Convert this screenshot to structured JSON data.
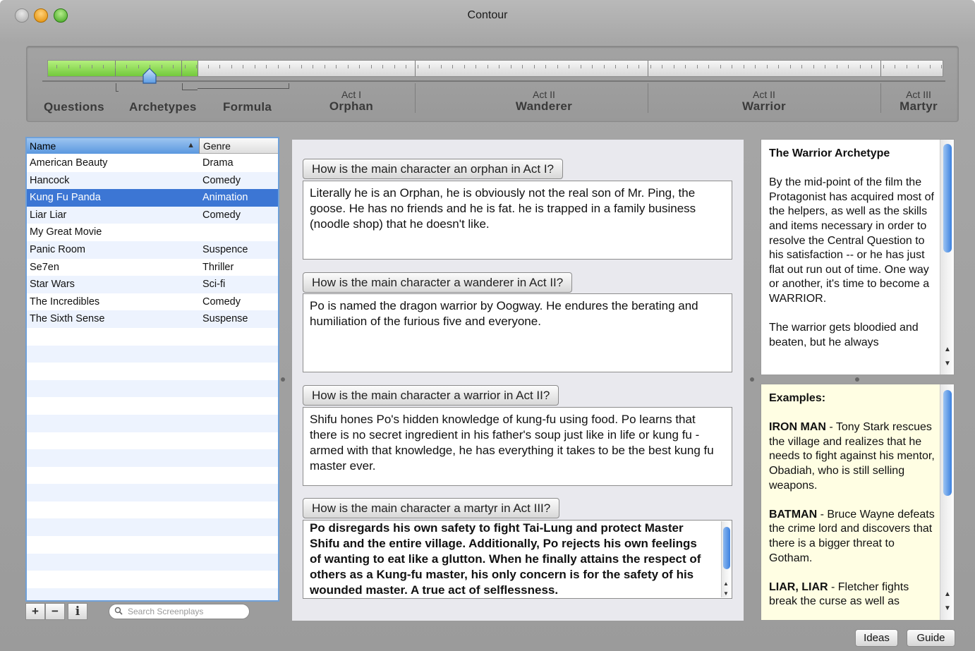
{
  "window": {
    "title": "Contour"
  },
  "timeline": {
    "progress": 0.168,
    "stages": [
      "Questions",
      "Archetypes",
      "Formula"
    ],
    "acts": [
      {
        "num": "Act I",
        "name": "Orphan"
      },
      {
        "num": "Act II",
        "name": "Wanderer"
      },
      {
        "num": "Act II",
        "name": "Warrior"
      },
      {
        "num": "Act III",
        "name": "Martyr"
      }
    ]
  },
  "table": {
    "columns": {
      "name": "Name",
      "genre": "Genre"
    },
    "rows": [
      {
        "name": "American Beauty",
        "genre": "Drama"
      },
      {
        "name": "Hancock",
        "genre": "Comedy"
      },
      {
        "name": "Kung Fu Panda",
        "genre": "Animation"
      },
      {
        "name": "Liar Liar",
        "genre": "Comedy"
      },
      {
        "name": "My Great Movie",
        "genre": ""
      },
      {
        "name": "Panic Room",
        "genre": "Suspence"
      },
      {
        "name": "Se7en",
        "genre": "Thriller"
      },
      {
        "name": "Star Wars",
        "genre": "Sci-fi"
      },
      {
        "name": "The Incredibles",
        "genre": "Comedy"
      },
      {
        "name": "The Sixth Sense",
        "genre": "Suspense"
      }
    ],
    "selected_index": 2,
    "tools": {
      "add": "+",
      "remove": "−",
      "info": "i"
    },
    "search_placeholder": "Search Screenplays"
  },
  "questions": [
    {
      "label": "How is the main character an orphan in Act I?",
      "answer": "Literally he is an Orphan, he is obviously not the real son of Mr. Ping, the goose. He has no friends and he is fat. he is trapped in a family business (noodle shop) that he doesn't like."
    },
    {
      "label": "How is the main character a wanderer in Act II?",
      "answer": "Po is named the dragon warrior by Oogway. He endures the berating and humiliation of the furious five and everyone."
    },
    {
      "label": "How is the main character a warrior in Act II?",
      "answer": "Shifu hones Po's hidden knowledge of kung-fu using food. Po learns that there is no secret ingredient in his father's soup just like in life or kung fu - armed with that knowledge, he has everything it takes to be the best kung fu master ever."
    },
    {
      "label": "How is the main character a martyr in Act III?",
      "answer": "Po disregards his own safety to fight Tai-Lung and protect Master Shifu and the entire village. Additionally, Po rejects his own feelings of wanting to eat like a glutton. When he finally attains the respect of others as a Kung-fu master, his only concern is for the safety of his wounded master. A true act of selflessness."
    }
  ],
  "archetype": {
    "title": "The Warrior Archetype",
    "para1": "By the mid-point of the film the Protagonist has acquired most of the helpers, as well as the skills and items necessary in order to resolve the Central Question to his satisfaction -- or he has just flat out run out of time. One way or another, it's time to become a WARRIOR.",
    "para2": "The warrior gets bloodied and beaten, but he always"
  },
  "examples": {
    "heading": "Examples:",
    "items": [
      {
        "name": "IRON MAN",
        "text": " - Tony Stark rescues the village and realizes that he needs to fight against his mentor, Obadiah, who is still selling weapons."
      },
      {
        "name": "BATMAN",
        "text": " - Bruce Wayne defeats the crime lord and discovers that there is a bigger threat to Gotham."
      },
      {
        "name": "LIAR, LIAR",
        "text": " - Fletcher fights break the curse as well as"
      }
    ]
  },
  "buttons": {
    "ideas": "Ideas",
    "guide": "Guide"
  }
}
